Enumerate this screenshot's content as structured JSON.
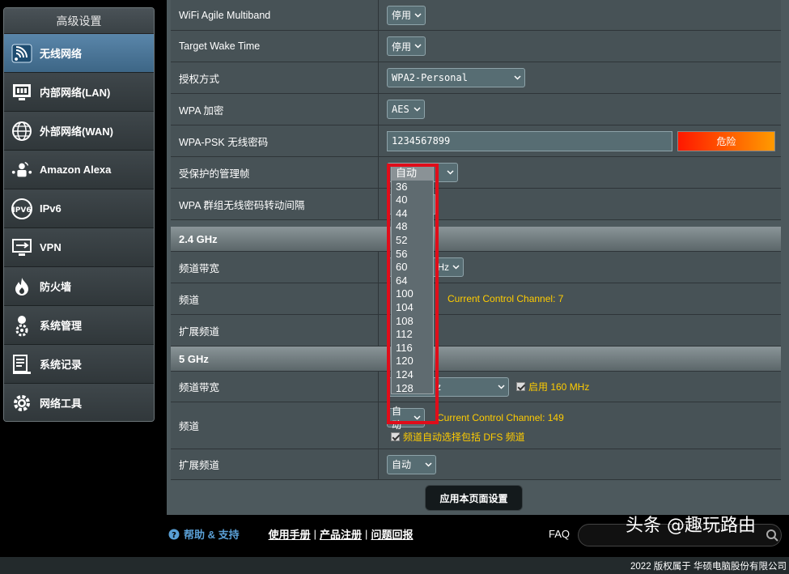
{
  "sidebar": {
    "title": "高级设置",
    "items": [
      {
        "label": "无线网络",
        "icon": "wifi-icon"
      },
      {
        "label": "内部网络(LAN)",
        "icon": "lan-icon"
      },
      {
        "label": "外部网络(WAN)",
        "icon": "globe-icon"
      },
      {
        "label": "Amazon Alexa",
        "icon": "alexa-icon"
      },
      {
        "label": "IPv6",
        "icon": "ipv6-icon"
      },
      {
        "label": "VPN",
        "icon": "vpn-icon"
      },
      {
        "label": "防火墙",
        "icon": "firewall-icon"
      },
      {
        "label": "系统管理",
        "icon": "admin-icon"
      },
      {
        "label": "系统记录",
        "icon": "log-icon"
      },
      {
        "label": "网络工具",
        "icon": "tools-gear-icon"
      }
    ]
  },
  "rows": {
    "agile_multiband": {
      "label": "WiFi Agile Multiband",
      "value": "停用"
    },
    "target_wake_time": {
      "label": "Target Wake Time",
      "value": "停用"
    },
    "auth_method": {
      "label": "授权方式",
      "value": "WPA2-Personal"
    },
    "wpa_encryption": {
      "label": "WPA 加密",
      "value": "AES"
    },
    "wpa_psk": {
      "label": "WPA-PSK 无线密码",
      "value": "1234567899",
      "strength": "危险"
    },
    "pmf": {
      "label": "受保护的管理帧",
      "value": "自动"
    },
    "group_key": {
      "label": "WPA 群组无线密码转动间隔"
    }
  },
  "band24": {
    "title": "2.4 GHz",
    "bandwidth_label": "频道带宽",
    "bandwidth_value_partial": "Hz",
    "channel_label": "频道",
    "current_channel": "Current Control Channel: 7",
    "ext_label": "扩展频道"
  },
  "band5": {
    "title": "5 GHz",
    "bandwidth_label": "频道带宽",
    "bandwidth_value_partial": "z",
    "enable_160": "启用 160 MHz",
    "channel_label": "频道",
    "channel_value": "自动",
    "current_channel": "Current Control Channel: 149",
    "dfs_text": "频道自动选择包括 DFS 频道",
    "ext_label": "扩展频道",
    "ext_value": "自动"
  },
  "channel_dropdown": {
    "options": [
      "自动",
      "36",
      "40",
      "44",
      "48",
      "52",
      "56",
      "60",
      "64",
      "100",
      "104",
      "108",
      "112",
      "116",
      "120",
      "124",
      "128"
    ],
    "selected": "自动"
  },
  "apply_button": "应用本页面设置",
  "footer": {
    "help_label": "帮助 & 支持",
    "links": [
      "使用手册",
      "产品注册",
      "问题回报"
    ],
    "faq_label": "FAQ",
    "watermark": "头条 @趣玩路由",
    "copyright": "2022 版权属于 华硕电脑股份有限公司"
  },
  "colors": {
    "accent_active": "#4a7598",
    "highlight_yellow": "#ffcc00",
    "annotation_red": "#e00d1a"
  }
}
